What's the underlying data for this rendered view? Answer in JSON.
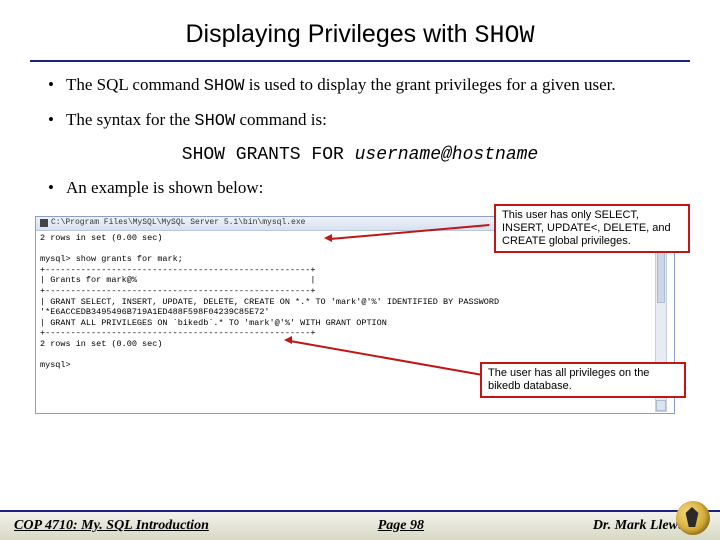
{
  "title": {
    "pre": "Displaying Privileges with ",
    "mono": "SHOW"
  },
  "bullets": {
    "b1_a": "The SQL command ",
    "b1_mono": "SHOW",
    "b1_b": " is used to display the grant privileges for a given user.",
    "b2_a": "The syntax for the ",
    "b2_mono": "SHOW",
    "b2_b": " command is:",
    "b3": "An example is shown below:"
  },
  "syntax": {
    "cmd": "SHOW GRANTS FOR ",
    "arg": "username@hostname"
  },
  "callouts": {
    "c1": "This user has only SELECT, INSERT, UPDATE<, DELETE, and CREATE global privileges.",
    "c2": "The user has all privileges on the bikedb database."
  },
  "terminal": {
    "title": "C:\\Program Files\\MySQL\\MySQL Server 5.1\\bin\\mysql.exe",
    "body": "2 rows in set (0.00 sec)\n\nmysql> show grants for mark;\n+----------------------------------------------------+\n| Grants for mark@%                                  |\n+----------------------------------------------------+\n| GRANT SELECT, INSERT, UPDATE, DELETE, CREATE ON *.* TO 'mark'@'%' IDENTIFIED BY PASSWORD\n'*E6ACCEDB3495496B719A1ED488F598F04239C85E72'\n| GRANT ALL PRIVILEGES ON `bikedb`.* TO 'mark'@'%' WITH GRANT OPTION\n+----------------------------------------------------+\n2 rows in set (0.00 sec)\n\nmysql>"
  },
  "footer": {
    "left": "COP 4710: My. SQL Introduction",
    "mid": "Page 98",
    "right": "Dr. Mark Llewellyn"
  }
}
